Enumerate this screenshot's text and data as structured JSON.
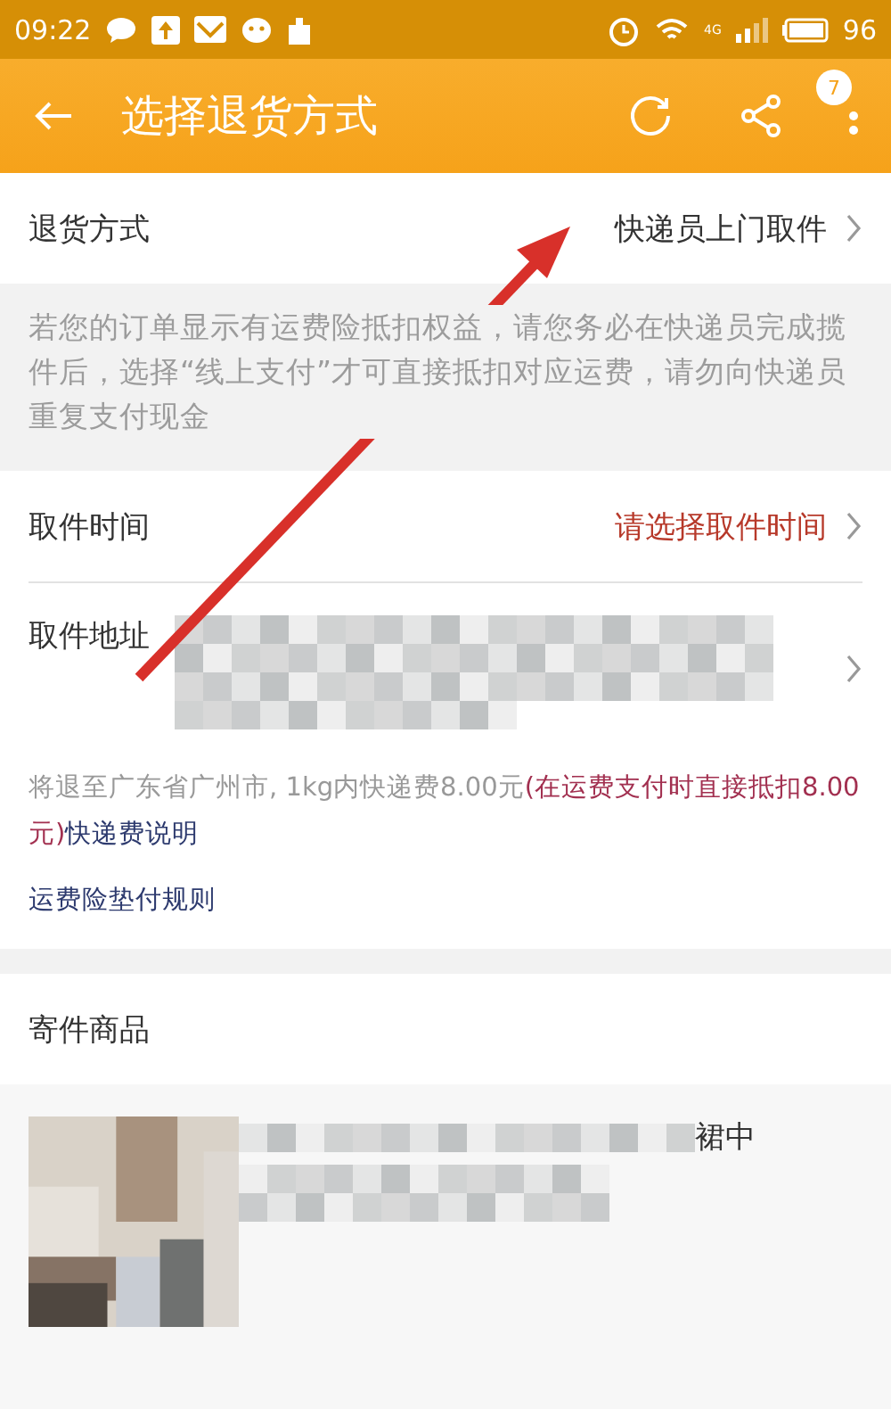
{
  "status_bar": {
    "time": "09:22",
    "network": "4G",
    "battery": "96"
  },
  "header": {
    "title": "选择退货方式",
    "badge": "7"
  },
  "return_method": {
    "label": "退货方式",
    "value": "快递员上门取件"
  },
  "notice": "若您的订单显示有运费险抵扣权益，请您务必在快递员完成揽件后，选择“线上支付”才可直接抵扣对应运费，请勿向快递员重复支付现金",
  "pickup_time": {
    "label": "取件时间",
    "value": "请选择取件时间"
  },
  "pickup_address": {
    "label": "取件地址"
  },
  "shipping_info": {
    "text": "将退至广东省广州市, 1kg内快递费8.00元",
    "highlight": "(在运费支付时直接抵扣8.00元)",
    "link": "快递费说明"
  },
  "insurance_link": "运费险垫付规则",
  "items_section": {
    "title": "寄件商品",
    "items": [
      {
        "kind": "picture",
        "title_visible": "裙中"
      }
    ]
  }
}
